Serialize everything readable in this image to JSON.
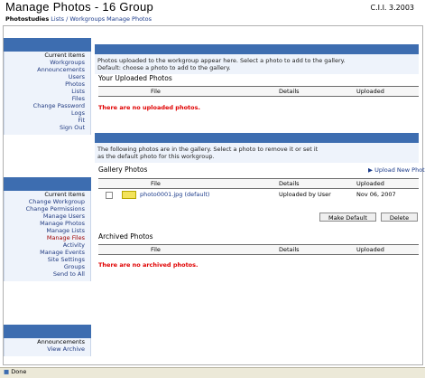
{
  "page": {
    "title": "Manage Photos - 16 Group",
    "top_right": "C.I.I. 3.2003"
  },
  "breadcrumb": {
    "current": "Photostudies",
    "links": [
      "Lists / Workgroups",
      "Manage Photos"
    ]
  },
  "sidebar1": {
    "items": [
      {
        "label": "Current Items",
        "kind": "hdr"
      },
      {
        "label": "Workgroups",
        "kind": "link"
      },
      {
        "label": "Announcements",
        "kind": "link"
      },
      {
        "label": "Users",
        "kind": "link"
      },
      {
        "label": "Photos",
        "kind": "link"
      },
      {
        "label": "Lists",
        "kind": "link"
      },
      {
        "label": "Files",
        "kind": "link"
      },
      {
        "label": "Change Password",
        "kind": "link"
      },
      {
        "label": "Logs",
        "kind": "link"
      },
      {
        "label": "Fit",
        "kind": "link"
      },
      {
        "label": "Sign Out",
        "kind": "link"
      }
    ]
  },
  "sidebar2": {
    "items": [
      {
        "label": "Current Items",
        "kind": "hdr"
      },
      {
        "label": "Change Workgroup",
        "kind": "link"
      },
      {
        "label": "Change Permissions",
        "kind": "link"
      },
      {
        "label": "Manage Users",
        "kind": "link"
      },
      {
        "label": "Manage Photos",
        "kind": "link"
      },
      {
        "label": "Manage Lists",
        "kind": "link"
      },
      {
        "label": "Manage Files",
        "kind": "red"
      },
      {
        "label": "Activity",
        "kind": "link"
      },
      {
        "label": "Manage Events",
        "kind": "link"
      },
      {
        "label": "Site Settings",
        "kind": "link"
      },
      {
        "label": "Groups",
        "kind": "link"
      },
      {
        "label": "Send to All",
        "kind": "link"
      }
    ]
  },
  "sidebar3": {
    "items": [
      {
        "label": "Announcements",
        "kind": "hdr"
      },
      {
        "label": "View Archive",
        "kind": "link"
      }
    ]
  },
  "panel1": {
    "desc_line1": "Photos uploaded to the workgroup appear here. Select a photo to add to the gallery.",
    "desc_line2": "Default: choose a photo to add to the gallery.",
    "section": "Your Uploaded Photos",
    "cols": [
      "File",
      "Details",
      "Uploaded"
    ],
    "error": "There are no uploaded photos."
  },
  "panel2": {
    "desc_line1": "The following photos are in the gallery. Select a photo to remove it or set it",
    "desc_line2": "as the default photo for this workgroup.",
    "section": "Gallery Photos",
    "upload_link": "Upload New Photo",
    "cols": [
      "File",
      "Details",
      "Uploaded"
    ],
    "row": {
      "file": "photo0001.jpg (default)",
      "details": "Uploaded by User",
      "date": "Nov 06, 2007"
    },
    "buttons": [
      "Make Default",
      "Delete"
    ],
    "section2": "Archived Photos",
    "cols2": [
      "File",
      "Details",
      "Uploaded"
    ],
    "error2": "There are no archived photos."
  },
  "statusbar": {
    "text": "Done"
  }
}
